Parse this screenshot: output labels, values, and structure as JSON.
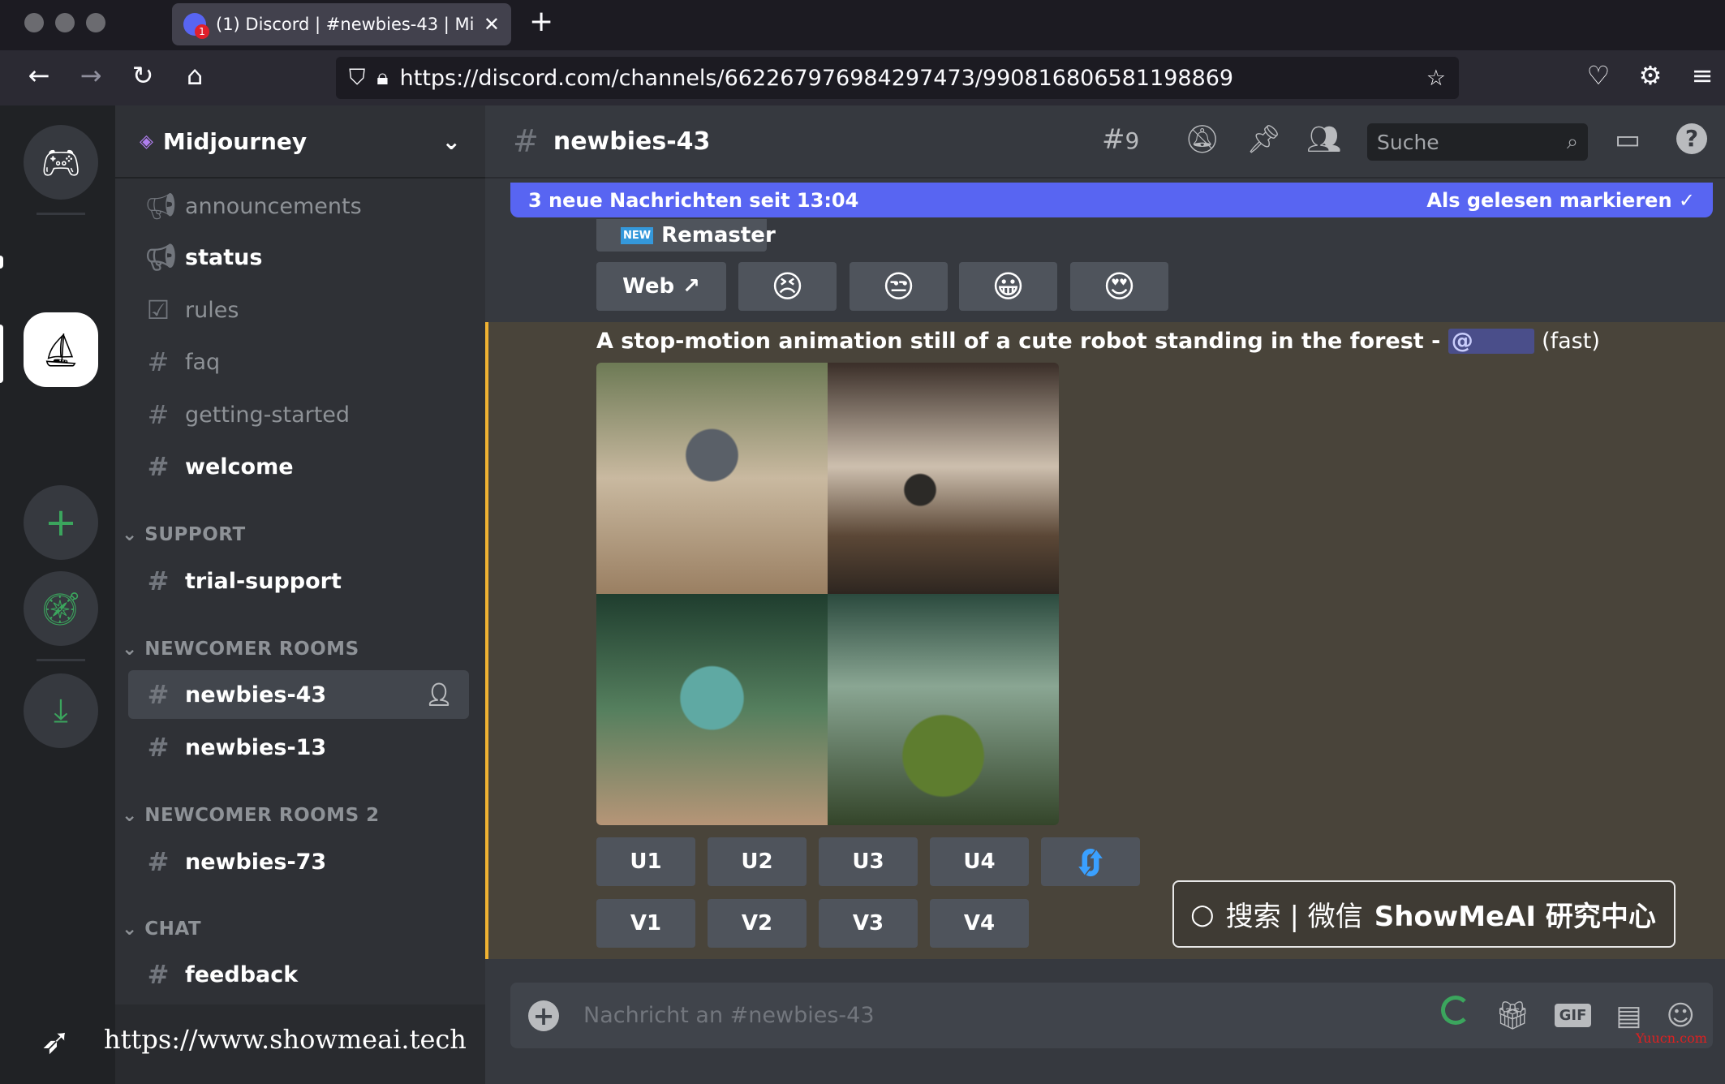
{
  "browser": {
    "tab_title": "(1) Discord | #newbies-43 | Midjourney",
    "tab_badge": "1",
    "url": "https://discord.com/channels/662267976984297473/990816806581198869"
  },
  "server": {
    "name": "Midjourney"
  },
  "channels": [
    {
      "label": "announcements",
      "icon": "megaphone-icon",
      "state": "read"
    },
    {
      "label": "status",
      "icon": "megaphone-icon",
      "state": "unread"
    },
    {
      "label": "rules",
      "icon": "checkbox-icon",
      "state": "read"
    },
    {
      "label": "faq",
      "icon": "hash-icon",
      "state": "read"
    },
    {
      "label": "getting-started",
      "icon": "hash-icon",
      "state": "read"
    },
    {
      "label": "welcome",
      "icon": "thread-hash-icon",
      "state": "unread"
    }
  ],
  "categories": {
    "support": "SUPPORT",
    "newcomer": "NEWCOMER ROOMS",
    "newcomer2": "NEWCOMER ROOMS 2",
    "chat": "CHAT"
  },
  "support_channels": [
    {
      "label": "trial-support"
    }
  ],
  "newcomer_channels": [
    {
      "label": "newbies-43",
      "selected": true
    },
    {
      "label": "newbies-13"
    }
  ],
  "newcomer2_channels": [
    {
      "label": "newbies-73"
    }
  ],
  "chat_channels": [
    {
      "label": "feedback"
    }
  ],
  "header": {
    "channel": "newbies-43",
    "threads_count": "9",
    "search_placeholder": "Suche"
  },
  "banner": {
    "text": "3 neue Nachrichten seit 13:04",
    "action": "Als gelesen markieren"
  },
  "prev_message": {
    "remaster_badge": "NEW",
    "remaster_label": "Remaster",
    "web_label": "Web",
    "reactions": [
      "😣",
      "😒",
      "😀",
      "😍"
    ]
  },
  "message": {
    "prompt": "A stop-motion animation still of a cute  robot standing in the forest - ",
    "mention": "@",
    "suffix": "(fast)",
    "upscale": [
      "U1",
      "U2",
      "U3",
      "U4"
    ],
    "variation": [
      "V1",
      "V2",
      "V3",
      "V4"
    ]
  },
  "watermark": {
    "text": "搜索 | 微信 ",
    "brand": "ShowMeAI 研究中心"
  },
  "footer_link": "https://www.showmeai.tech",
  "corner_mark": "Yuucn.com",
  "composer": {
    "placeholder": "Nachricht an #newbies-43",
    "gif": "GIF"
  },
  "colors": {
    "accent": "#5865f2",
    "highlight_border": "#f0b232",
    "online": "#3ba55d"
  }
}
